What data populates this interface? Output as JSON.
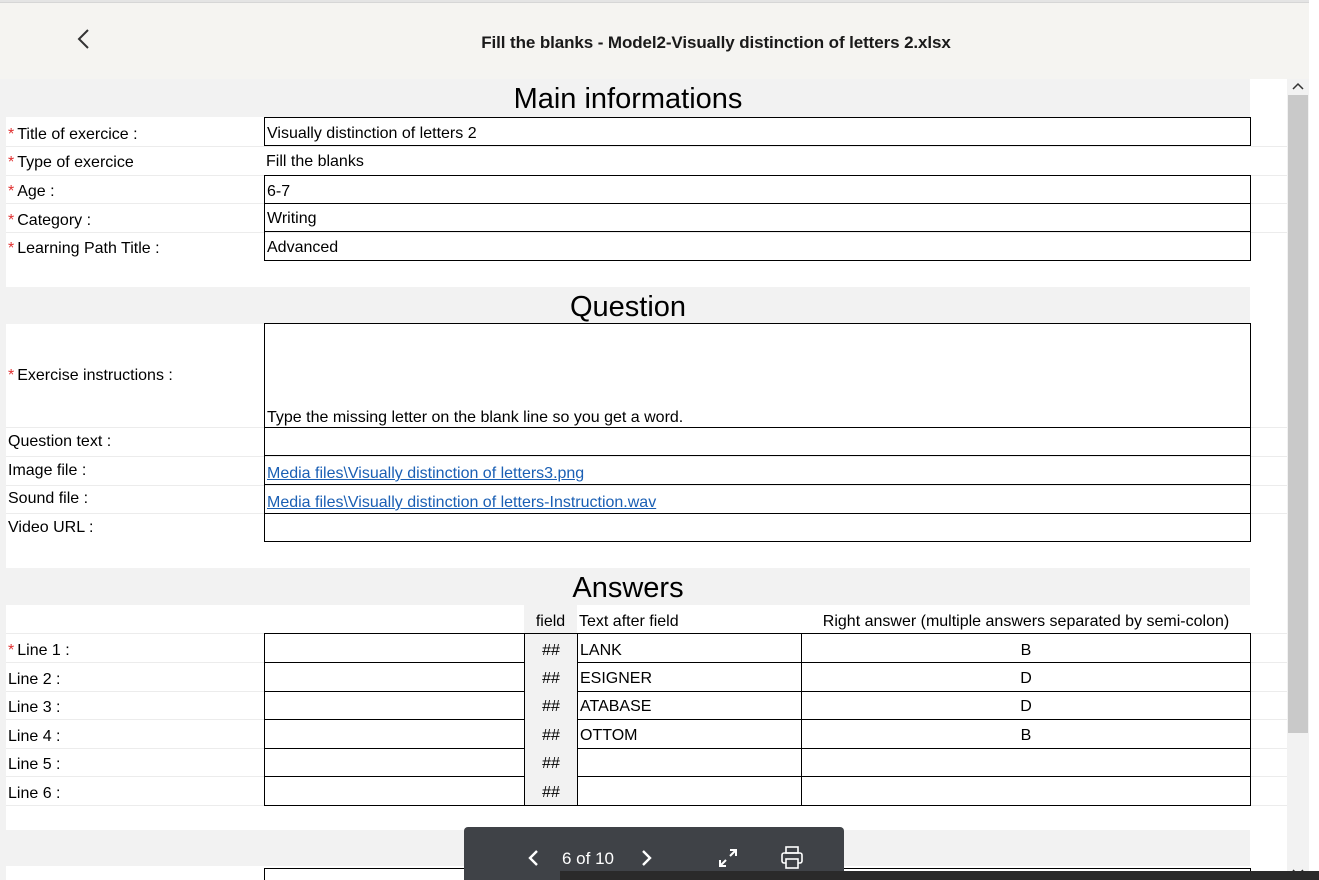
{
  "header": {
    "title": "Fill the blanks - Model2-Visually distinction of letters 2.xlsx",
    "back_icon": "chevron-left-icon"
  },
  "main_info": {
    "section_title": "Main informations",
    "rows": [
      {
        "label": "Title of exercice :",
        "value": "Visually distinction of letters 2"
      },
      {
        "label": "Type of exercice",
        "value": "Fill the blanks"
      },
      {
        "label": "Age :",
        "value": "6-7"
      },
      {
        "label": "Category :",
        "value": "Writing"
      },
      {
        "label": "Learning Path Title :",
        "value": "Advanced"
      }
    ]
  },
  "question": {
    "section_title": "Question",
    "instructions_label": "Exercise instructions :",
    "instructions_value": "Type the missing letter on the blank line so you get a word.",
    "question_text_label": "Question text :",
    "question_text_value": "",
    "image_file_label": "Image file :",
    "image_file_value": "Media files\\Visually distinction of letters3.png",
    "sound_file_label": "Sound file :",
    "sound_file_value": "Media files\\Visually distinction of letters-Instruction.wav",
    "video_url_label": "Video URL :",
    "video_url_value": ""
  },
  "answers": {
    "section_title": "Answers",
    "columns": {
      "field": "field",
      "text_after": "Text after field",
      "right_answer": "Right answer (multiple answers separated by semi-colon)"
    },
    "required_mark": "*",
    "lines": [
      {
        "label": "Line 1 :",
        "before": "",
        "field": "##",
        "after": "LANK",
        "answer": "B"
      },
      {
        "label": "Line 2 :",
        "before": "",
        "field": "##",
        "after": "ESIGNER",
        "answer": "D"
      },
      {
        "label": "Line 3 :",
        "before": "",
        "field": "##",
        "after": "ATABASE",
        "answer": "D"
      },
      {
        "label": "Line 4 :",
        "before": "",
        "field": "##",
        "after": "OTTOM",
        "answer": "B"
      },
      {
        "label": "Line 5 :",
        "before": "",
        "field": "##",
        "after": "",
        "answer": ""
      },
      {
        "label": "Line 6 :",
        "before": "",
        "field": "##",
        "after": "",
        "answer": ""
      }
    ]
  },
  "pager": {
    "text": "6 of 10",
    "prev_icon": "chevron-left-icon",
    "next_icon": "chevron-right-icon",
    "expand_icon": "expand-icon",
    "print_icon": "printer-icon"
  },
  "colors": {
    "required": "#e03030",
    "link": "#1a5fb4",
    "pager_bg": "#3f4247"
  }
}
